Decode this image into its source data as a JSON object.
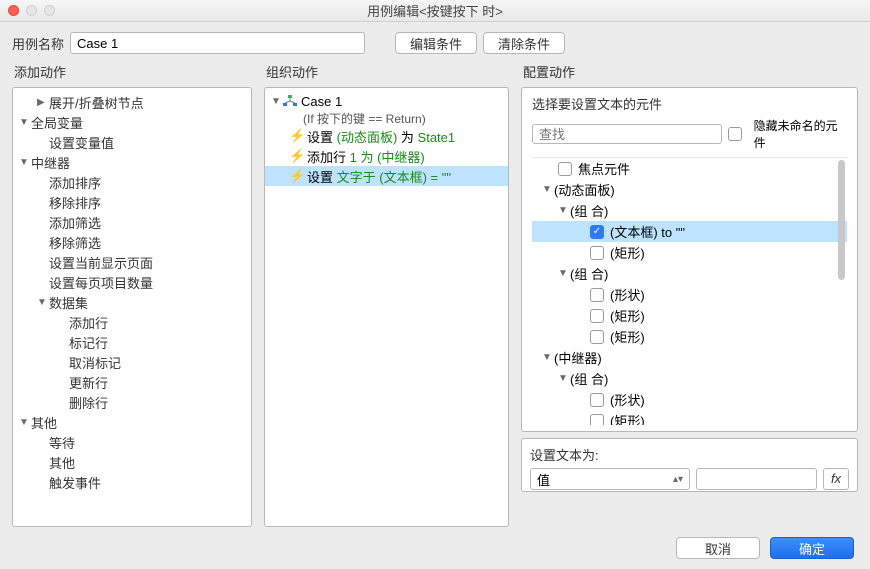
{
  "window": {
    "title": "用例编辑<按键按下 时>"
  },
  "toprow": {
    "case_label": "用例名称",
    "case_value": "Case 1",
    "edit_cond": "编辑条件",
    "clear_cond": "清除条件"
  },
  "columns": {
    "left_head": "添加动作",
    "mid_head": "组织动作",
    "right_head": "配置动作"
  },
  "left_tree": {
    "expand_tree": "展开/折叠树节点",
    "globals": "全局变量",
    "set_var": "设置变量值",
    "repeater": "中继器",
    "add_sort": "添加排序",
    "remove_sort": "移除排序",
    "add_filter": "添加筛选",
    "remove_filter": "移除筛选",
    "set_page": "设置当前显示页面",
    "set_page_items": "设置每页项目数量",
    "dataset": "数据集",
    "ds_add": "添加行",
    "ds_mark": "标记行",
    "ds_unmark": "取消标记",
    "ds_update": "更新行",
    "ds_delete": "删除行",
    "others": "其他",
    "wait": "等待",
    "other": "其他",
    "fire": "触发事件"
  },
  "mid": {
    "case_name": "Case 1",
    "condition": "(If 按下的键 == Return)",
    "act1_pre": "设置 ",
    "act1_g1": "(动态面板)",
    "act1_mid": " 为 ",
    "act1_g2": "State1",
    "act2_pre": "添加行 ",
    "act2_g1": "1 为 (中继器)",
    "act3_pre": "设置 ",
    "act3_g1": "文字于 (文本框) = \"\""
  },
  "right": {
    "select_label": "选择要设置文本的元件",
    "search_placeholder": "查找",
    "hide_unnamed": "隐藏未命名的元件",
    "focus": "焦点元件",
    "dpanel": "(动态面板)",
    "group": "(组 合)",
    "textbox_to": "(文本框) to \"\"",
    "rect": "(矩形)",
    "shape": "(形状)",
    "repeater": "(中继器)",
    "set_text_label": "设置文本为:",
    "set_text_select": "值"
  },
  "footer": {
    "cancel": "取消",
    "ok": "确定"
  }
}
